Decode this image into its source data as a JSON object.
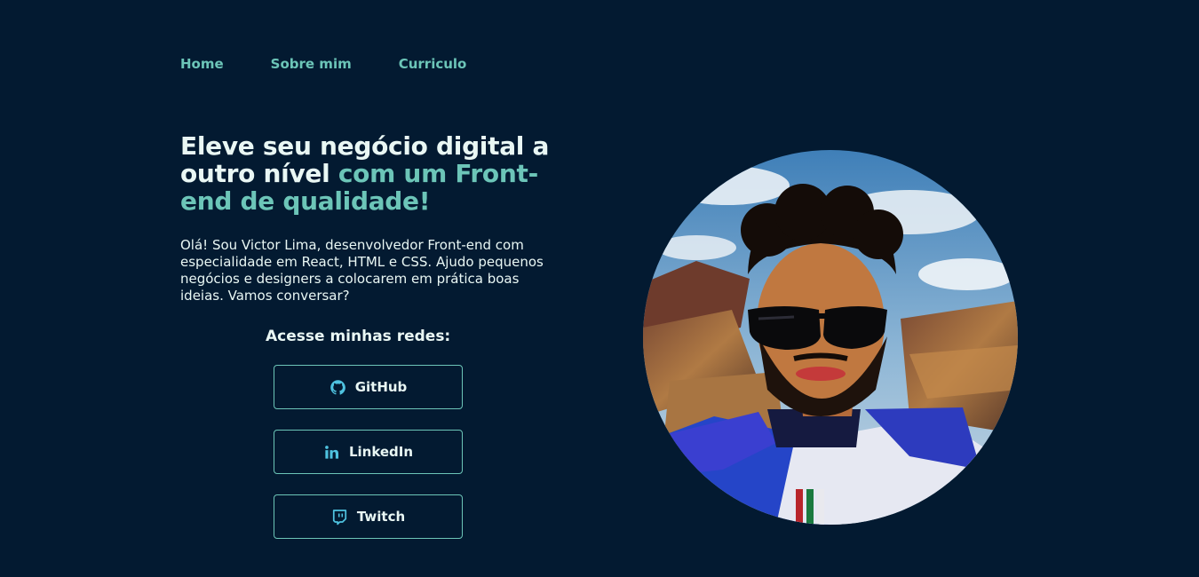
{
  "nav": {
    "items": [
      {
        "label": "Home"
      },
      {
        "label": "Sobre mim"
      },
      {
        "label": "Curriculo"
      }
    ]
  },
  "hero": {
    "headline_part1": "Eleve seu negócio digital a outro nível ",
    "headline_accent": "com um Front-end de qualidade!",
    "intro": "Olá! Sou Victor Lima, desenvolvedor Front-end com especialidade em React, HTML e CSS. Ajudo pequenos negócios e designers a colocarem em prática boas ideias. Vamos conversar?"
  },
  "social": {
    "title": "Acesse minhas redes:",
    "buttons": [
      {
        "label": "GitHub",
        "icon": "github-icon"
      },
      {
        "label": "LinkedIn",
        "icon": "linkedin-icon"
      },
      {
        "label": "Twitch",
        "icon": "twitch-icon"
      }
    ]
  },
  "colors": {
    "background": "#031A31",
    "accent": "#6CC5B8",
    "text": "#E9F7F4"
  }
}
